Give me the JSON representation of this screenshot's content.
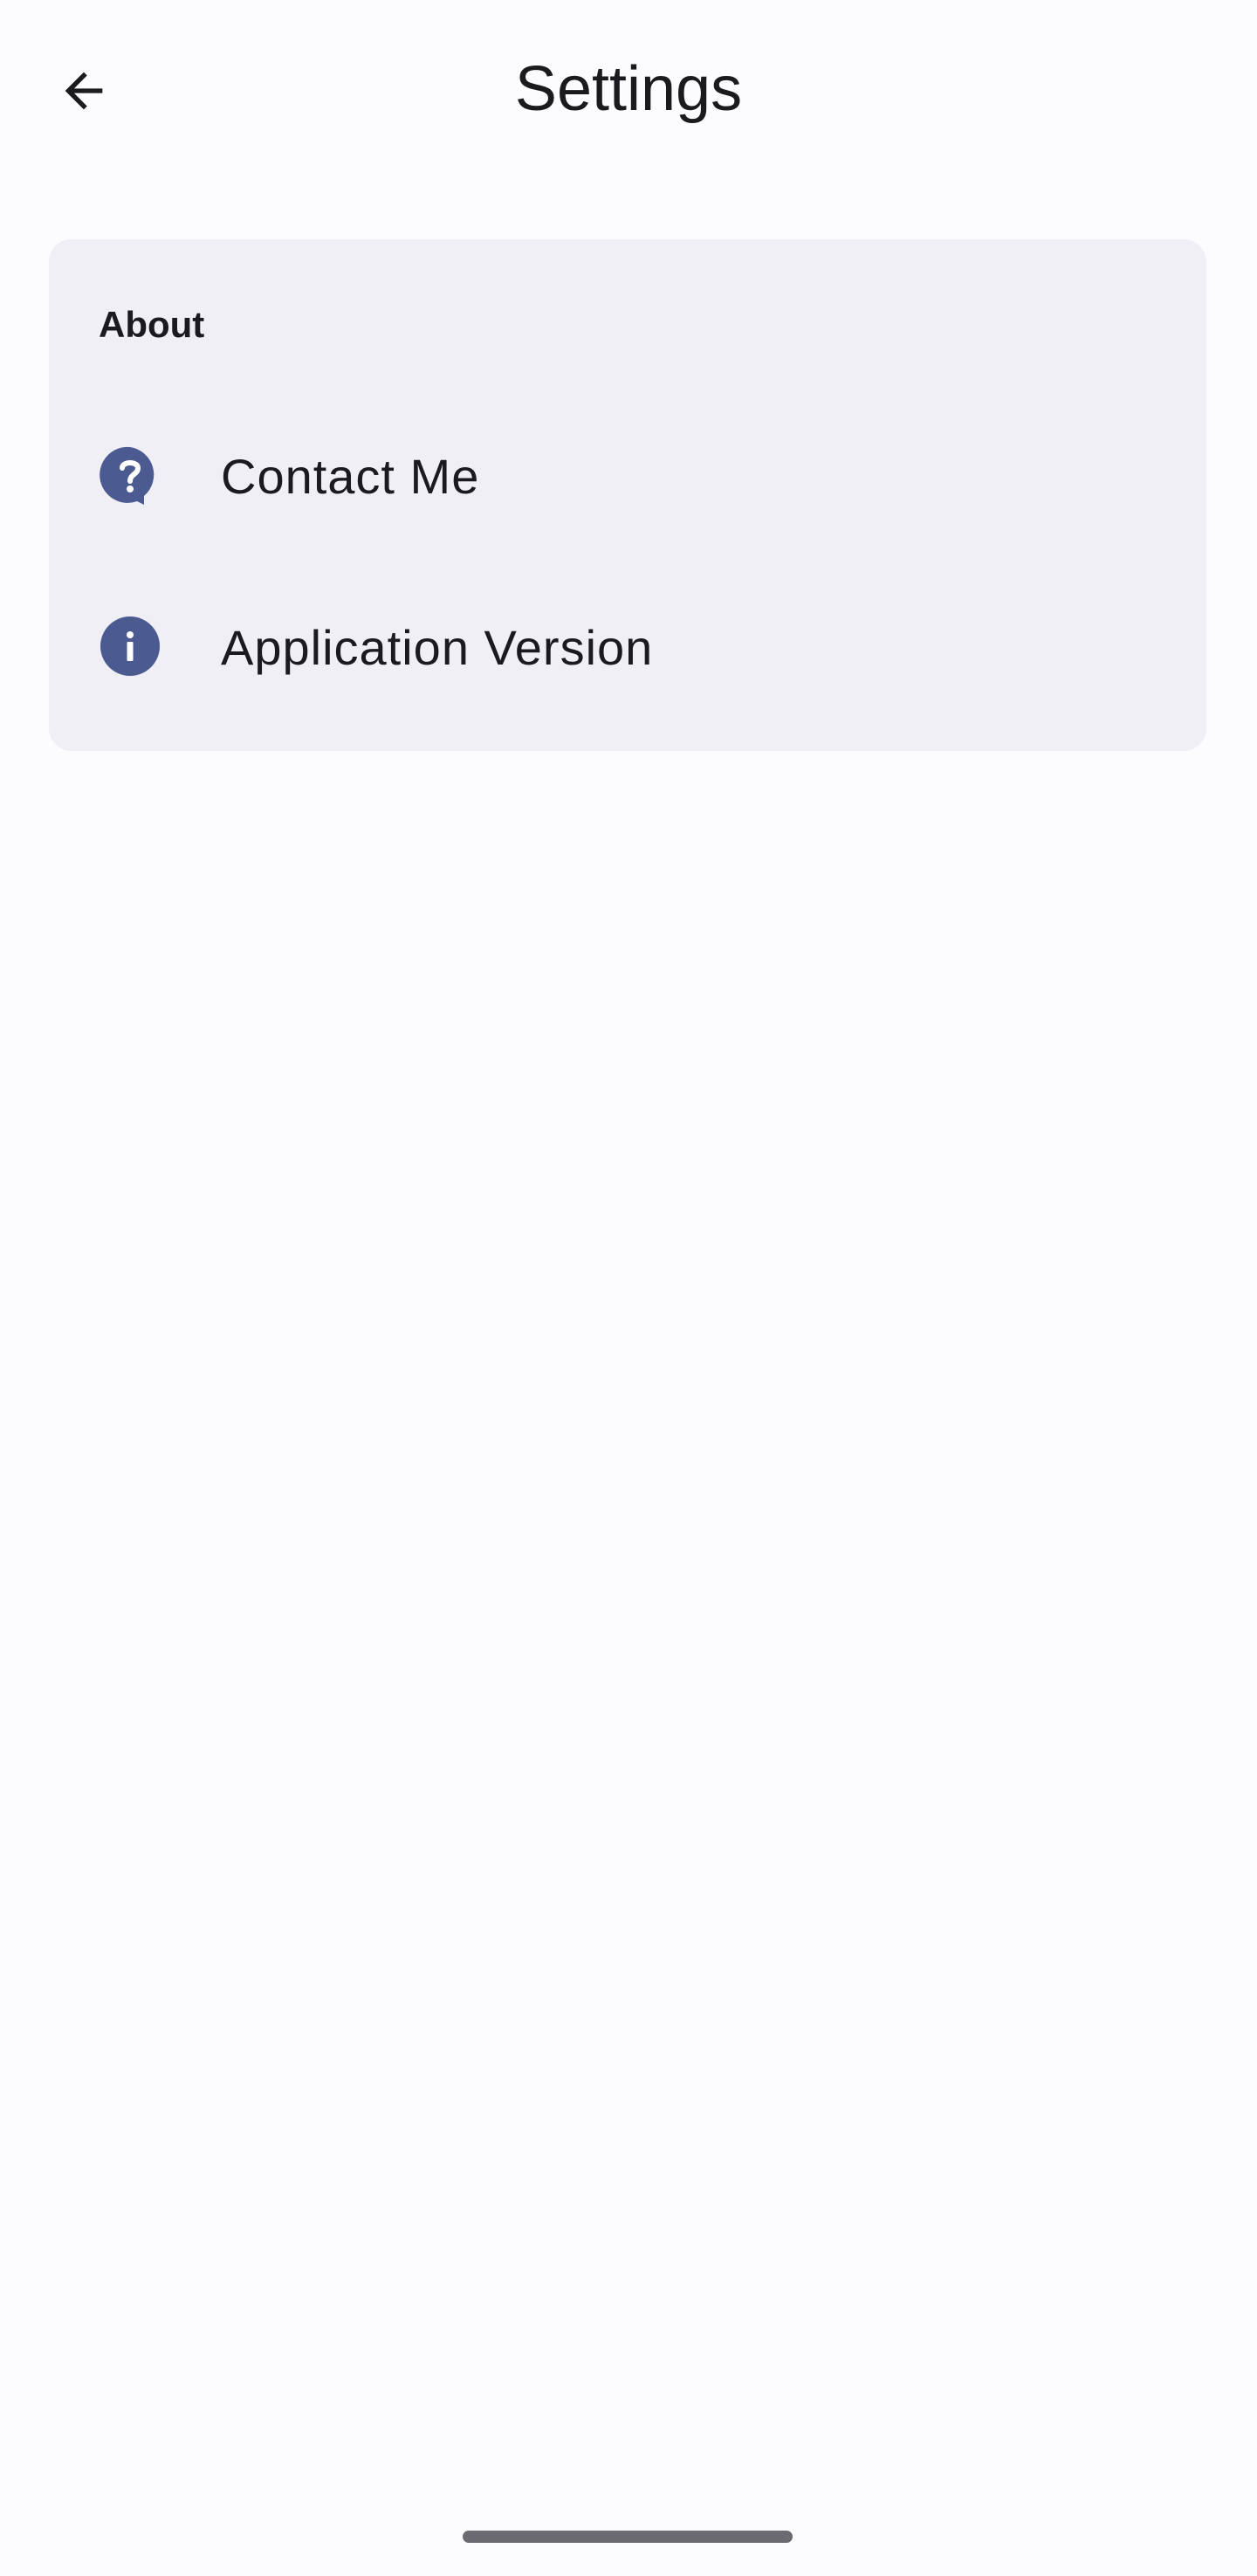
{
  "header": {
    "title": "Settings",
    "back_icon": "arrow-back-icon"
  },
  "about_section": {
    "title": "About",
    "items": [
      {
        "label": "Contact Me",
        "icon": "help-bubble-icon"
      },
      {
        "label": "Application Version",
        "icon": "info-icon"
      }
    ]
  },
  "colors": {
    "background": "#fcfbfe",
    "card": "#efeff5",
    "icon_accent": "#4b5a91",
    "text": "#1b1b1f",
    "home_indicator": "#6a6a70"
  }
}
